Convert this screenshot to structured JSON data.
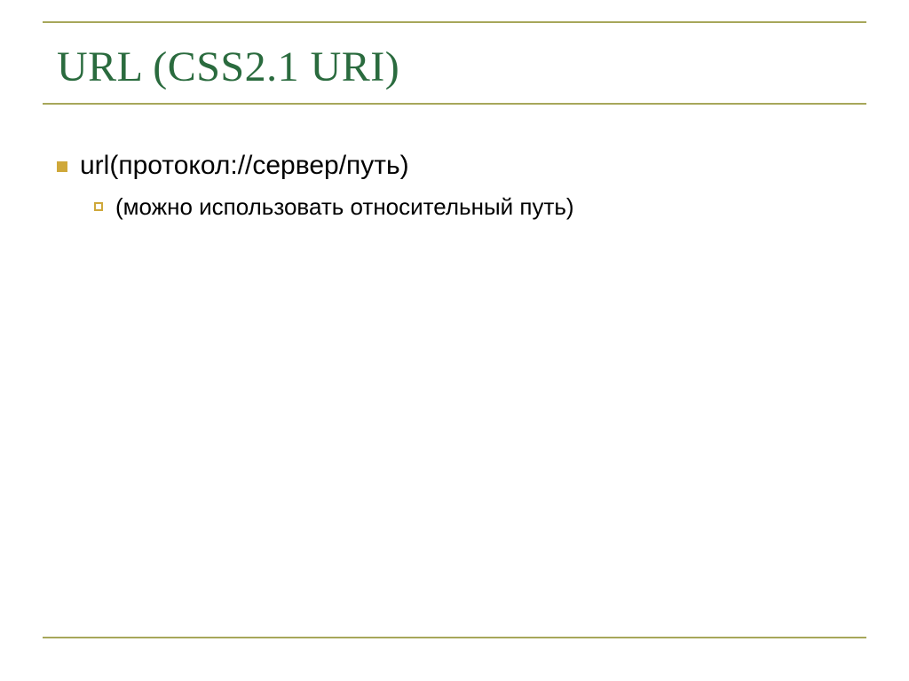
{
  "title": "URL (CSS2.1 URI)",
  "bullets": {
    "level1": "url(протокол://сервер/путь)",
    "level2": "(можно использовать относительный путь)"
  },
  "colors": {
    "title": "#2a6b3e",
    "rule": "#a7a75a",
    "bullet": "#cfa83a"
  }
}
